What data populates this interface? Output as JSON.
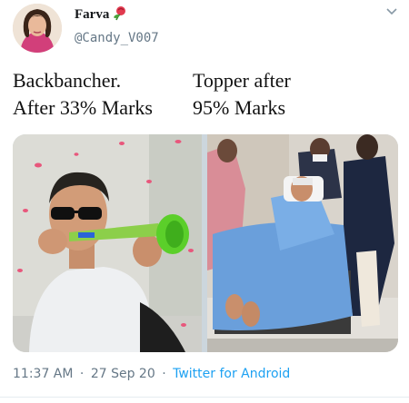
{
  "author": {
    "display_name": "Farva",
    "name_emoji": "rose-icon",
    "handle": "@Candy_V007"
  },
  "tweet": {
    "lines": [
      {
        "left": "Backbancher.",
        "right": "Topper after"
      },
      {
        "left": "After 33% Marks",
        "right": "95% Marks"
      }
    ]
  },
  "media": {
    "left_photo": "man-blowing-vuvuzela-with-rose-petals",
    "right_photo": "patient-on-hospital-stretcher"
  },
  "meta": {
    "time": "11:37 AM",
    "separator": "·",
    "date": "27 Sep 20",
    "source": "Twitter for Android"
  },
  "colors": {
    "link": "#1da1f2",
    "secondary_text": "#657786"
  }
}
